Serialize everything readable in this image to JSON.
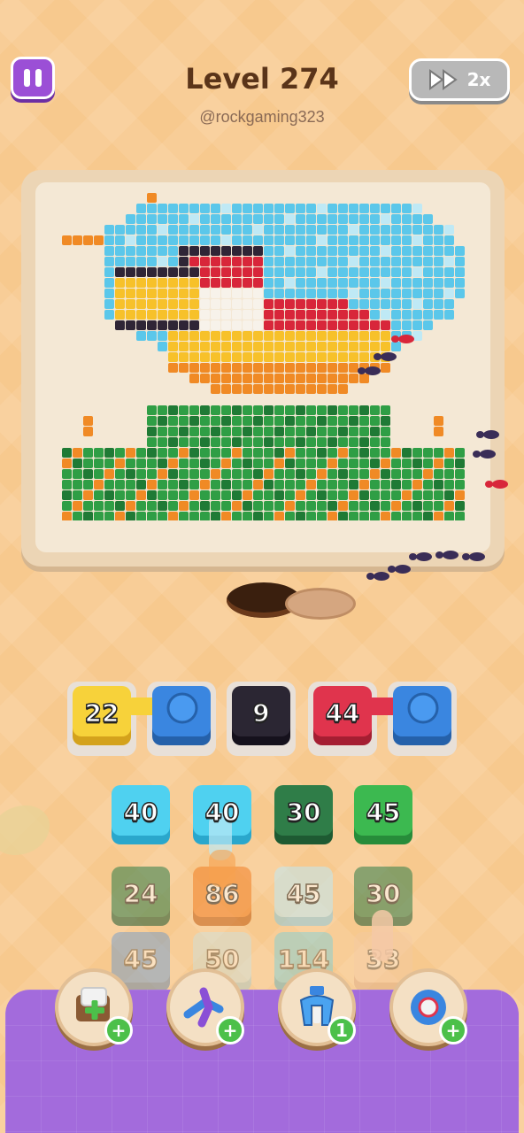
{
  "header": {
    "level_title": "Level 274",
    "channel_tag": "@rockgaming323",
    "speed_label": "2x"
  },
  "picture": {
    "subject": "toucan-pixel-art",
    "palette": {
      "sky": "#5bc7ea",
      "sky_light": "#bfe9f5",
      "orange": "#f08a25",
      "yellow": "#f7c12a",
      "red": "#d8263a",
      "dark": "#2f2536",
      "white": "#f7f2ea",
      "green": "#2f9e45",
      "dark_green": "#1f7a35"
    }
  },
  "conveyor": [
    {
      "value": "22",
      "color": "#f7d23a"
    },
    {
      "value": "",
      "color": "#3a86e0"
    },
    {
      "value": "9",
      "color": "#2b2633"
    },
    {
      "value": "44",
      "color": "#e0344d"
    },
    {
      "value": "",
      "color": "#3a86e0"
    }
  ],
  "grid": [
    [
      {
        "value": "40",
        "color": "#4fd1f0"
      },
      {
        "value": "40",
        "color": "#4fd1f0"
      },
      {
        "value": "30",
        "color": "#2f7d48"
      },
      {
        "value": "45",
        "color": "#3cb950"
      }
    ],
    [
      {
        "value": "24",
        "color": "#2f7d48"
      },
      {
        "value": "86",
        "color": "#f27f24"
      },
      {
        "value": "45",
        "color": "#bfe9f5"
      },
      {
        "value": "30",
        "color": "#2f7d48"
      }
    ],
    [
      {
        "value": "45",
        "color": "#3a86e0"
      },
      {
        "value": "50",
        "color": "#bfe9f5"
      },
      {
        "value": "114",
        "color": "#4fd1f0"
      },
      {
        "value": "33",
        "color": "#f4c9a7"
      }
    ]
  ],
  "boosters": [
    {
      "name": "add-box",
      "badge": "+"
    },
    {
      "name": "shuffle",
      "badge": "+"
    },
    {
      "name": "magnet",
      "badge": "1"
    },
    {
      "name": "ring",
      "badge": "+"
    }
  ]
}
